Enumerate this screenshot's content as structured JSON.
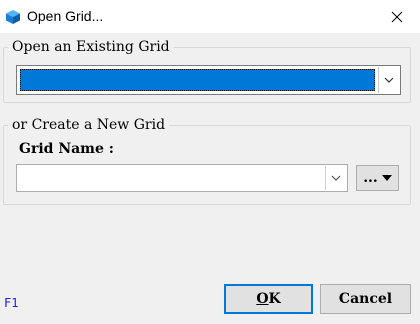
{
  "window": {
    "title": "Open Grid..."
  },
  "icons": {
    "app": "cube-icon",
    "close": "close-icon",
    "dropdown": "chevron-down-icon",
    "browse_arrow": "triangle-down-icon"
  },
  "existing_grid": {
    "legend": "Open an Existing Grid",
    "selected_value": ""
  },
  "new_grid": {
    "legend": "or Create a New Grid",
    "name_label": "Grid Name :",
    "name_value": "",
    "browse_label": "..."
  },
  "footer": {
    "help_key": "F1",
    "ok_label": "K",
    "ok_mnemonic": "O",
    "cancel_label": "Cancel"
  },
  "colors": {
    "selection": "#0078d7",
    "default_button_border": "#0078d7",
    "help_key": "#2020d0"
  }
}
